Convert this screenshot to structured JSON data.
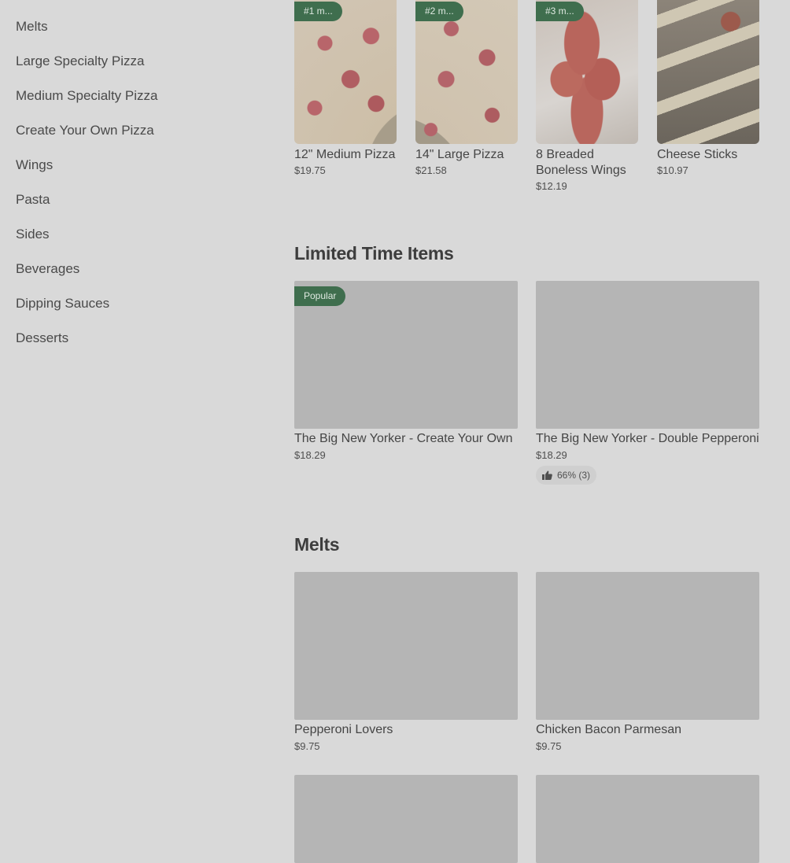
{
  "sidebar": {
    "items": [
      {
        "label": "Melts"
      },
      {
        "label": "Large Specialty Pizza"
      },
      {
        "label": "Medium Specialty Pizza"
      },
      {
        "label": "Create Your Own Pizza"
      },
      {
        "label": "Wings"
      },
      {
        "label": "Pasta"
      },
      {
        "label": "Sides"
      },
      {
        "label": "Beverages"
      },
      {
        "label": "Dipping Sauces"
      },
      {
        "label": "Desserts"
      }
    ]
  },
  "top_items": [
    {
      "badge": "#1 m...",
      "name": "12\" Medium Pizza",
      "price": "$19.75",
      "image": "pizza-image"
    },
    {
      "badge": "#2 m...",
      "name": "14\" Large Pizza",
      "price": "$21.58",
      "image": "pizza-image"
    },
    {
      "badge": "#3 m...",
      "name": "8 Breaded Boneless Wings",
      "price": "$12.19",
      "image": "wings-image"
    },
    {
      "badge": "",
      "name": "Cheese Sticks",
      "price": "$10.97",
      "image": "cheese-sticks-image"
    }
  ],
  "limited_time": {
    "title": "Limited Time Items",
    "items": [
      {
        "badge": "Popular",
        "name": "The Big New Yorker - Create Your Own",
        "price": "$18.29"
      },
      {
        "badge": "",
        "name": "The Big New Yorker - Double Pepperoni",
        "price": "$18.29",
        "rating": "66% (3)",
        "rating_icon": "thumbs-up-icon"
      }
    ]
  },
  "melts": {
    "title": "Melts",
    "items": [
      {
        "name": "Pepperoni Lovers",
        "price": "$9.75"
      },
      {
        "name": "Chicken Bacon Parmesan",
        "price": "$9.75"
      }
    ]
  },
  "colors": {
    "badge_bg": "#3f6e4e",
    "page_bg": "#d9d9d9",
    "placeholder": "#b5b5b5"
  }
}
